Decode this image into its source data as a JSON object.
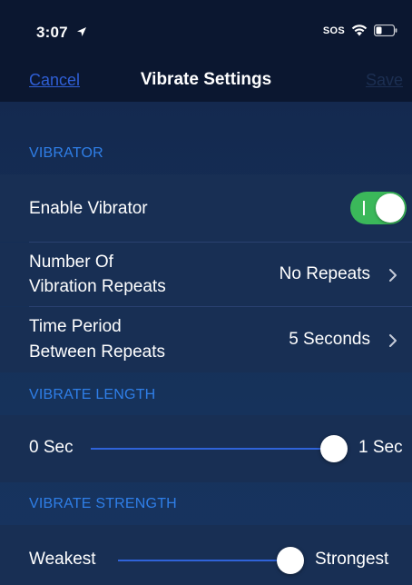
{
  "status_bar": {
    "time": "3:07",
    "sos": "SOS",
    "icons": [
      "location-arrow-icon",
      "wifi-icon",
      "battery-icon"
    ]
  },
  "nav": {
    "cancel": "Cancel",
    "title": "Vibrate Settings",
    "save": "Save"
  },
  "sections": {
    "vibrator": {
      "header": "VIBRATOR",
      "enable_label": "Enable Vibrator",
      "enable_on": true,
      "repeats_label_line1": "Number Of",
      "repeats_label_line2": "Vibration Repeats",
      "repeats_value": "No Repeats",
      "period_label_line1": "Time Period",
      "period_label_line2": "Between Repeats",
      "period_value": "5 Seconds"
    },
    "length": {
      "header": "VIBRATE LENGTH",
      "min_label": "0 Sec",
      "max_label": "1 Sec",
      "value_fraction": 1.0
    },
    "strength": {
      "header": "VIBRATE STRENGTH",
      "min_label": "Weakest",
      "max_label": "Strongest",
      "value_fraction": 1.0
    }
  },
  "colors": {
    "background": "#0b1730",
    "accent": "#2f63d9",
    "section_header": "#2f7fe8",
    "toggle_on": "#3bb85a"
  }
}
